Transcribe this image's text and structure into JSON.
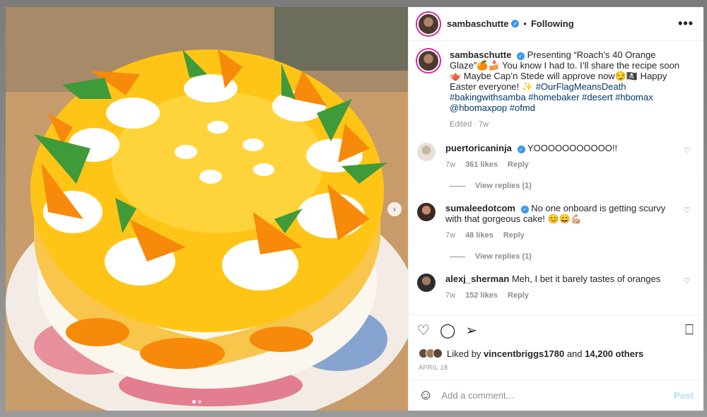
{
  "header": {
    "username": "sambaschutte",
    "follow_status": "Following",
    "separator": "•",
    "more": "•••"
  },
  "caption": {
    "username": "sambaschutte",
    "text_before": "Presenting “Roach’s 40 Orange Glaze”🍊🍰 You know I had to. I’ll share the recipe soon🫖 Maybe Cap’n Stede will approve now😏🏴‍☠️ Happy Easter everyone! ✨ ",
    "hashtags": "#OurFlagMeansDeath #bakingwithsamba #homebaker #desert #hbomax @hbomaxpop #ofmd",
    "edited": "Edited · 7w"
  },
  "comments": [
    {
      "username": "puertoricaninja",
      "verified": true,
      "text": "YOOOOOOOOOOO!!",
      "time": "7w",
      "likes": "361 likes",
      "reply": "Reply",
      "view_replies": "View replies (1)"
    },
    {
      "username": "sumaleedotcom",
      "verified": true,
      "text": "No one onboard is getting scurvy with that gorgeous cake! 😊😄💪🏼",
      "time": "7w",
      "likes": "48 likes",
      "reply": "Reply",
      "view_replies": "View replies (1)"
    },
    {
      "username": "alexj_sherman",
      "verified": false,
      "text": "Meh, I bet it barely tastes of oranges",
      "time": "7w",
      "likes": "152 likes",
      "reply": "Reply"
    }
  ],
  "actions": {
    "like": "♡",
    "comment": "◯",
    "share": "➢",
    "save": "⎕"
  },
  "likes": {
    "prefix": "Liked by",
    "user": "vincentbriggs1780",
    "middle": "and",
    "count": "14,200 others"
  },
  "date": "APRIL 18",
  "add_comment": {
    "placeholder": "Add a comment...",
    "post": "Post",
    "emoji": "☺"
  },
  "icons": [
    "chevron-right-icon",
    "heart-icon",
    "comment-icon",
    "share-icon",
    "bookmark-icon",
    "emoji-icon",
    "verified-icon",
    "more-icon"
  ]
}
